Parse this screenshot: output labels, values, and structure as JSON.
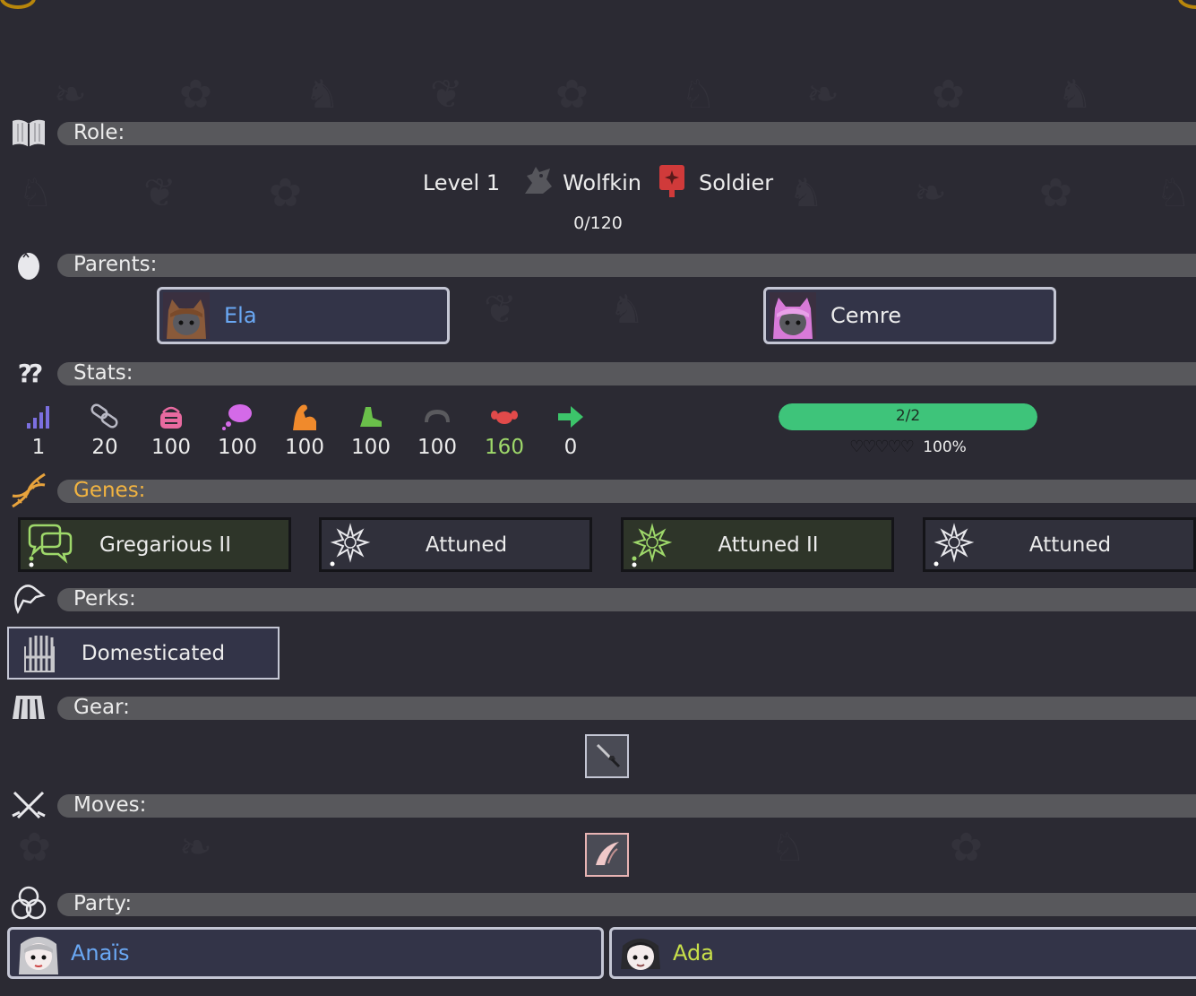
{
  "sections": {
    "role": "Role:",
    "parents": "Parents:",
    "stats": "Stats:",
    "genes": "Genes:",
    "perks": "Perks:",
    "gear": "Gear:",
    "moves": "Moves:",
    "party": "Party:"
  },
  "role": {
    "level": "Level 1",
    "race": "Wolfkin",
    "class": "Soldier",
    "xp": "0/120",
    "race_icon": "wolf-head-icon",
    "class_icon": "banner-icon"
  },
  "parents": [
    {
      "name": "Ela",
      "name_color": "#6aa8f4"
    },
    {
      "name": "Cemre",
      "name_color": "#ececec"
    }
  ],
  "stats": [
    {
      "icon": "signal-bars-icon",
      "value": "1",
      "color": "#7b6fe0"
    },
    {
      "icon": "chain-link-icon",
      "value": "20",
      "color": "#b8b8c4"
    },
    {
      "icon": "basket-icon",
      "value": "100",
      "color": "#e86aa0"
    },
    {
      "icon": "thought-bubble-icon",
      "value": "100",
      "color": "#d46ae8"
    },
    {
      "icon": "flexed-arm-icon",
      "value": "100",
      "color": "#f08a2c"
    },
    {
      "icon": "boot-icon",
      "value": "100",
      "color": "#6ac04a"
    },
    {
      "icon": "helmet-icon",
      "value": "100",
      "color": "#5a5a5e"
    },
    {
      "icon": "heart-icon",
      "value": "160",
      "color": "#e24a4a",
      "value_color": "#9ed86a"
    },
    {
      "icon": "arrow-right-icon",
      "value": "0",
      "color": "#3cc46a"
    }
  ],
  "health": {
    "bar_text": "2/2",
    "fill": 1.0,
    "hearts": "♡♡♡♡♡",
    "percent": "100%",
    "bar_color": "#3ec47a"
  },
  "genes": [
    {
      "label": "Gregarious II",
      "icon": "speech-bubbles-icon",
      "style": "green"
    },
    {
      "label": "Attuned",
      "icon": "starburst-icon",
      "style": "plain"
    },
    {
      "label": "Attuned II",
      "icon": "starburst-icon",
      "style": "green"
    },
    {
      "label": "Attuned",
      "icon": "starburst-icon",
      "style": "plain"
    }
  ],
  "perks": [
    {
      "label": "Domesticated",
      "icon": "gate-icon"
    }
  ],
  "gear": [
    {
      "icon": "dagger-icon"
    }
  ],
  "moves": [
    {
      "icon": "claw-slash-icon"
    }
  ],
  "party": [
    {
      "name": "Anaïs",
      "name_color": "#6aa8f4"
    },
    {
      "name": "Ada",
      "name_color": "#c8e04a"
    }
  ]
}
